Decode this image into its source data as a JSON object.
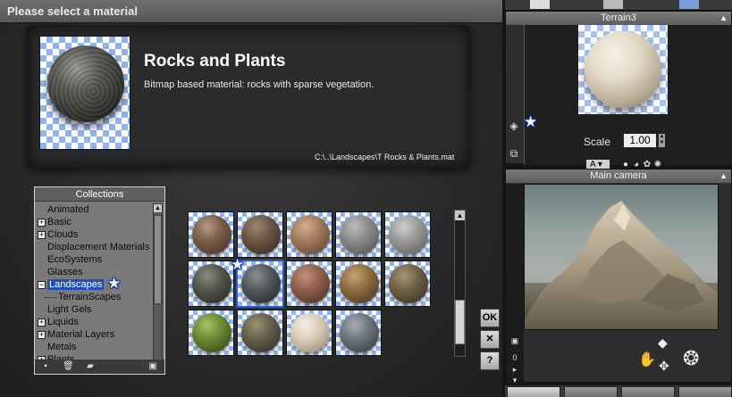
{
  "dialog": {
    "title": "Please select a material",
    "material_name": "Rocks and Plants",
    "material_description": "Bitmap based material: rocks with sparse vegetation.",
    "material_path": "C:\\..\\Landscapes\\T Rocks & Plants.mat"
  },
  "collections": {
    "header": "Collections",
    "items": [
      {
        "label": "Animated",
        "expandable": false,
        "selected": false
      },
      {
        "label": "Basic",
        "expandable": true,
        "selected": false
      },
      {
        "label": "Clouds",
        "expandable": true,
        "selected": false
      },
      {
        "label": "Displacement Materials",
        "expandable": false,
        "selected": false
      },
      {
        "label": "EcoSystems",
        "expandable": false,
        "selected": false
      },
      {
        "label": "Glasses",
        "expandable": false,
        "selected": false
      },
      {
        "label": "Landscapes",
        "expandable": true,
        "expanded": true,
        "selected": true
      },
      {
        "label": "TerrainScapes",
        "expandable": false,
        "child": true,
        "selected": false
      },
      {
        "label": "Light Gels",
        "expandable": false,
        "selected": false
      },
      {
        "label": "Liquids",
        "expandable": true,
        "selected": false
      },
      {
        "label": "Material Layers",
        "expandable": true,
        "selected": false
      },
      {
        "label": "Metals",
        "expandable": false,
        "selected": false
      },
      {
        "label": "Plants",
        "expandable": true,
        "selected": false
      }
    ],
    "footer_icons": [
      "new-collection-icon",
      "delete-icon",
      "open-folder-icon",
      "save-icon"
    ]
  },
  "thumbnails": [
    {
      "material": "rocky-brown",
      "selected": false
    },
    {
      "material": "cracked-brown",
      "selected": false
    },
    {
      "material": "tan-rock",
      "selected": false
    },
    {
      "material": "gray-stone",
      "selected": false
    },
    {
      "material": "gray-smooth",
      "selected": false
    },
    {
      "material": "dark-rock-moss",
      "selected": false
    },
    {
      "material": "rocks-and-plants",
      "selected": true
    },
    {
      "material": "reddish-rock",
      "selected": false
    },
    {
      "material": "ochre-rock",
      "selected": false
    },
    {
      "material": "mossy-rock",
      "selected": false
    },
    {
      "material": "green-moss",
      "selected": false
    },
    {
      "material": "olive-rock",
      "selected": false
    },
    {
      "material": "sand",
      "selected": false
    },
    {
      "material": "blue-gray-rock",
      "selected": false
    }
  ],
  "buttons": {
    "ok": "OK",
    "cancel": "✕",
    "help": "?"
  },
  "terrain_panel": {
    "title": "Terrain3",
    "scale_label": "Scale",
    "scale_value": "1.00",
    "mode_value": "A"
  },
  "camera_panel": {
    "title": "Main camera",
    "counter": "0"
  },
  "colors": {
    "accent_selection": "#2150b8",
    "dialog_title_bg": "#666666",
    "star_outline": "#1533c7"
  }
}
